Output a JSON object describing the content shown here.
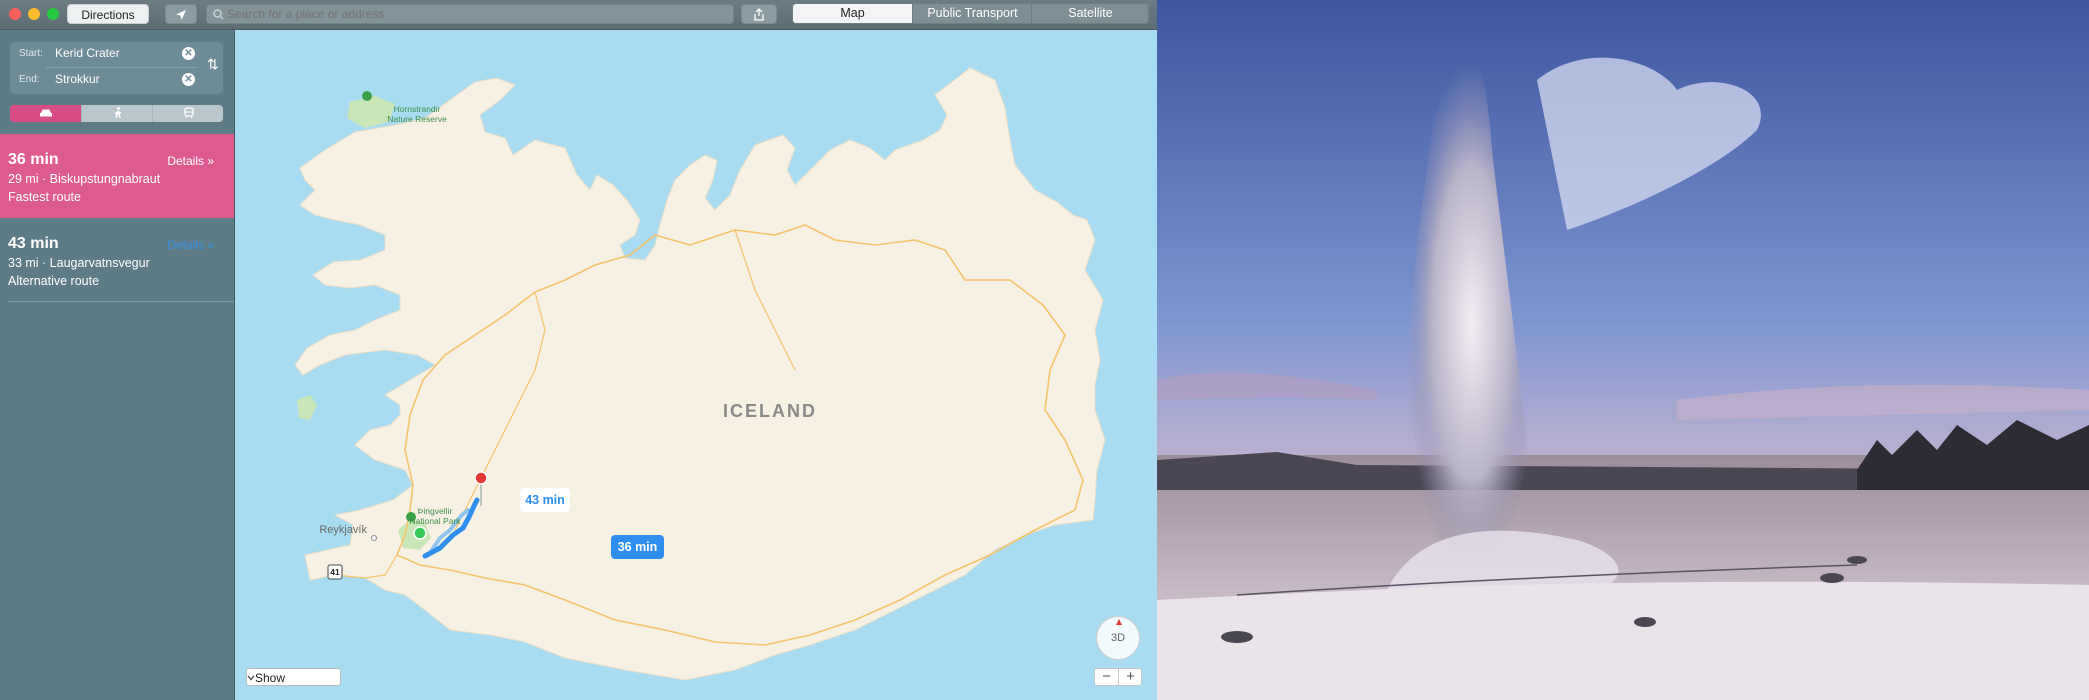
{
  "toolbar": {
    "directions_label": "Directions",
    "search_placeholder": "Search for a place or address",
    "view_tabs": [
      {
        "label": "Map",
        "active": true
      },
      {
        "label": "Public Transport",
        "active": false
      },
      {
        "label": "Satellite",
        "active": false
      }
    ]
  },
  "directions": {
    "start_label": "Start:",
    "start_value": "Kerid Crater",
    "end_label": "End:",
    "end_value": "Strokkur",
    "transport_modes": [
      {
        "icon": "car-icon",
        "active": true
      },
      {
        "icon": "walk-icon",
        "active": false
      },
      {
        "icon": "transit-icon",
        "active": false
      }
    ],
    "accent_color": "#dd5b8e"
  },
  "routes": [
    {
      "time": "36 min",
      "summary": "29 mi · Biskupstungnabraut",
      "type": "Fastest route",
      "details_label": "Details »",
      "selected": true
    },
    {
      "time": "43 min",
      "summary": "33 mi · Laugarvatnsvegur",
      "type": "Alternative route",
      "details_label": "Details »",
      "selected": false
    }
  ],
  "map": {
    "country_label": "ICELAND",
    "city_label": "Reykjavík",
    "poi_label_1": "Hornstrandir",
    "poi_label_2": "Nature Reserve",
    "park_label_1": "Þingvellir",
    "park_label_2": "National Park",
    "road_shield": "41",
    "badge_fast": "36 min",
    "badge_alt": "43 min",
    "show_label": "Show",
    "compass_label": "3D",
    "zoom_out": "−",
    "zoom_in": "+",
    "route_color": "#2f8fef"
  }
}
